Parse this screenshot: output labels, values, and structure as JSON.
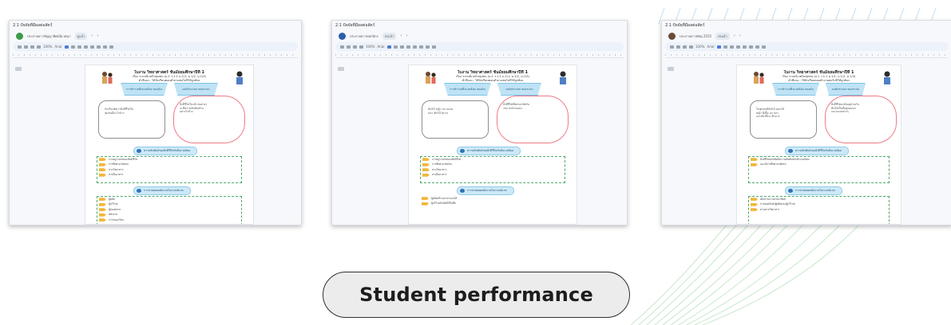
{
  "caption": {
    "label": "Student performance"
  },
  "colors": {
    "line_accent": "#a9d8f0",
    "line_green": "#9ad6a2",
    "bubble_pink": "#f07a86",
    "ribbon_blue": "#bfe3f5",
    "list_border_green": "#49a86a"
  },
  "screenshots": [
    {
      "doc_title": "2.1 ปัจจัยที่มีผลต่อสัตว์",
      "account_name": "ประกายดาวชัญญาพิศน์นิเวศนา",
      "status": "ดูแล้ว",
      "zoom": "100%",
      "font": "Arial",
      "worksheet": {
        "title": "ใบงาน วิทยาศาสตร์ ชั้นมัธยมศึกษาปีที่ 1",
        "subtitle1": "เรื่อง ระบบนิเวศในชุมชน (ม.1 ว.1.1 ม.1/1, ม.1/2, ม.1/3)",
        "subtitle2": "คำชี้แจง : ให้นักเรียนตอบคำถามต่อไปนี้ให้ถูกต้อง",
        "ribbon_left": "การสำรวจสิ่งแวดล้อม ของฉัน",
        "ribbon_right": "องค์ประกอบ ของระบบ",
        "grey_bubble_text": [
          "นักเรียนคิดว่าสิ่งมีชีวิตใน",
          "ชุมชนมีอะไรบ้าง"
        ],
        "pink_bubble_text": [
          "สิ่งมีชีวิตในบริเวณต่างๆ",
          "จะมีความสัมพันธ์กัน",
          "อย่างไรบ้าง"
        ],
        "section1": "ความสัมพันธ์ของสิ่งมีชีวิตกับสิ่งแวดล้อม",
        "list1": [
          "การอยู่ร่วมกันของสิ่งมีชีวิต",
          "การพึ่งพาอาศัยกัน",
          "ห่วงโซ่อาหาร",
          "สายใยอาหาร"
        ],
        "section2": "การถ่ายทอดพลังงานในระบบนิเวศ",
        "list2": [
          "ผู้ผลิต",
          "ผู้บริโภค",
          "ผู้ย่อยสลาย",
          "พลังงาน",
          "การหมุนเวียน"
        ]
      }
    },
    {
      "doc_title": "2.1 ปัจจัยที่มีผลต่อสัตว์",
      "account_name": "ประกายดาวพสกนิกร",
      "status": "ส่งแล้ว",
      "zoom": "100%",
      "font": "Arial",
      "worksheet": {
        "title": "ใบงาน วิทยาศาสตร์ ชั้นมัธยมศึกษาปีที่ 1",
        "subtitle1": "เรื่อง ระบบนิเวศในชุมชน (ม.1 ว.1.1 ม.1/1, ม.1/2, ม.1/3)",
        "subtitle2": "คำชี้แจง : ให้นักเรียนตอบคำถามต่อไปนี้ให้ถูกต้อง",
        "ribbon_left": "การสำรวจสิ่งแวดล้อม ของฉัน",
        "ribbon_right": "องค์ประกอบ ของระบบ",
        "grey_bubble_text": [
          "ต้นไม้ หญ้า นก แมลง",
          "ปลา สัตว์น้ำต่างๆ"
        ],
        "pink_bubble_text": [
          "สิ่งมีชีวิตพึ่งพาอาศัยกัน",
          "เช่น นกกินแมลง"
        ],
        "section1": "ความสัมพันธ์ของสิ่งมีชีวิตกับสิ่งแวดล้อม",
        "list1": [
          "การอยู่ร่วมกันของสิ่งมีชีวิต",
          "การพึ่งพาอาศัยกัน",
          "ห่วงโซ่อาหาร",
          "สายใยอาหาร"
        ],
        "section2": "การถ่ายทอดพลังงานในระบบนิเวศ",
        "list2": [
          "ผู้ผลิตสร้างอาหารเองได้",
          "ผู้บริโภคกินสิ่งมีชีวิตอื่น"
        ]
      }
    },
    {
      "doc_title": "2.1 ปัจจัยที่มีผลต่อสัตว์",
      "account_name": "ประกายดาวพัสดุ 2555",
      "status": "ส่งแล้ว",
      "zoom": "100%",
      "font": "Arial",
      "worksheet": {
        "title": "ใบงาน วิทยาศาสตร์ ชั้นมัธยมศึกษาปีที่ 1",
        "subtitle1": "เรื่อง ระบบนิเวศในชุมชน (ม.1 ว.1.1 ม.1/1, ม.1/2, ม.1/3)",
        "subtitle2": "คำชี้แจง : ให้นักเรียนตอบคำถามต่อไปนี้ให้ถูกต้อง",
        "ribbon_left": "การสำรวจสิ่งแวดล้อม ของฉัน",
        "ribbon_right": "องค์ประกอบ ของระบบ",
        "grey_bubble_text": [
          "ในชุมชนมีต้นไม้ ดอกไม้",
          "หญ้า ผีเสื้อ นก ปลา",
          "และสัตว์อื่นๆ อีกมาก"
        ],
        "pink_bubble_text": [
          "สิ่งมีชีวิตอาศัยอยู่ร่วมกัน",
          "ต้นไม้เป็นที่อยู่ของนก",
          "และแมลงต่างๆ"
        ],
        "section1": "ความสัมพันธ์ของสิ่งมีชีวิตกับสิ่งแวดล้อม",
        "list1": [
          "สิ่งมีชีวิตทุกชนิดมีความสัมพันธ์กับสิ่งแวดล้อม",
          "และมีการพึ่งพาอาศัยกัน"
        ],
        "section2": "การถ่ายทอดพลังงานในระบบนิเวศ",
        "list2": [
          "พลังงานจากดวงอาทิตย์",
          "ถ่ายทอดไปยังผู้ผลิตและผู้บริโภค",
          "ผ่านห่วงโซ่อาหาร"
        ]
      }
    }
  ]
}
